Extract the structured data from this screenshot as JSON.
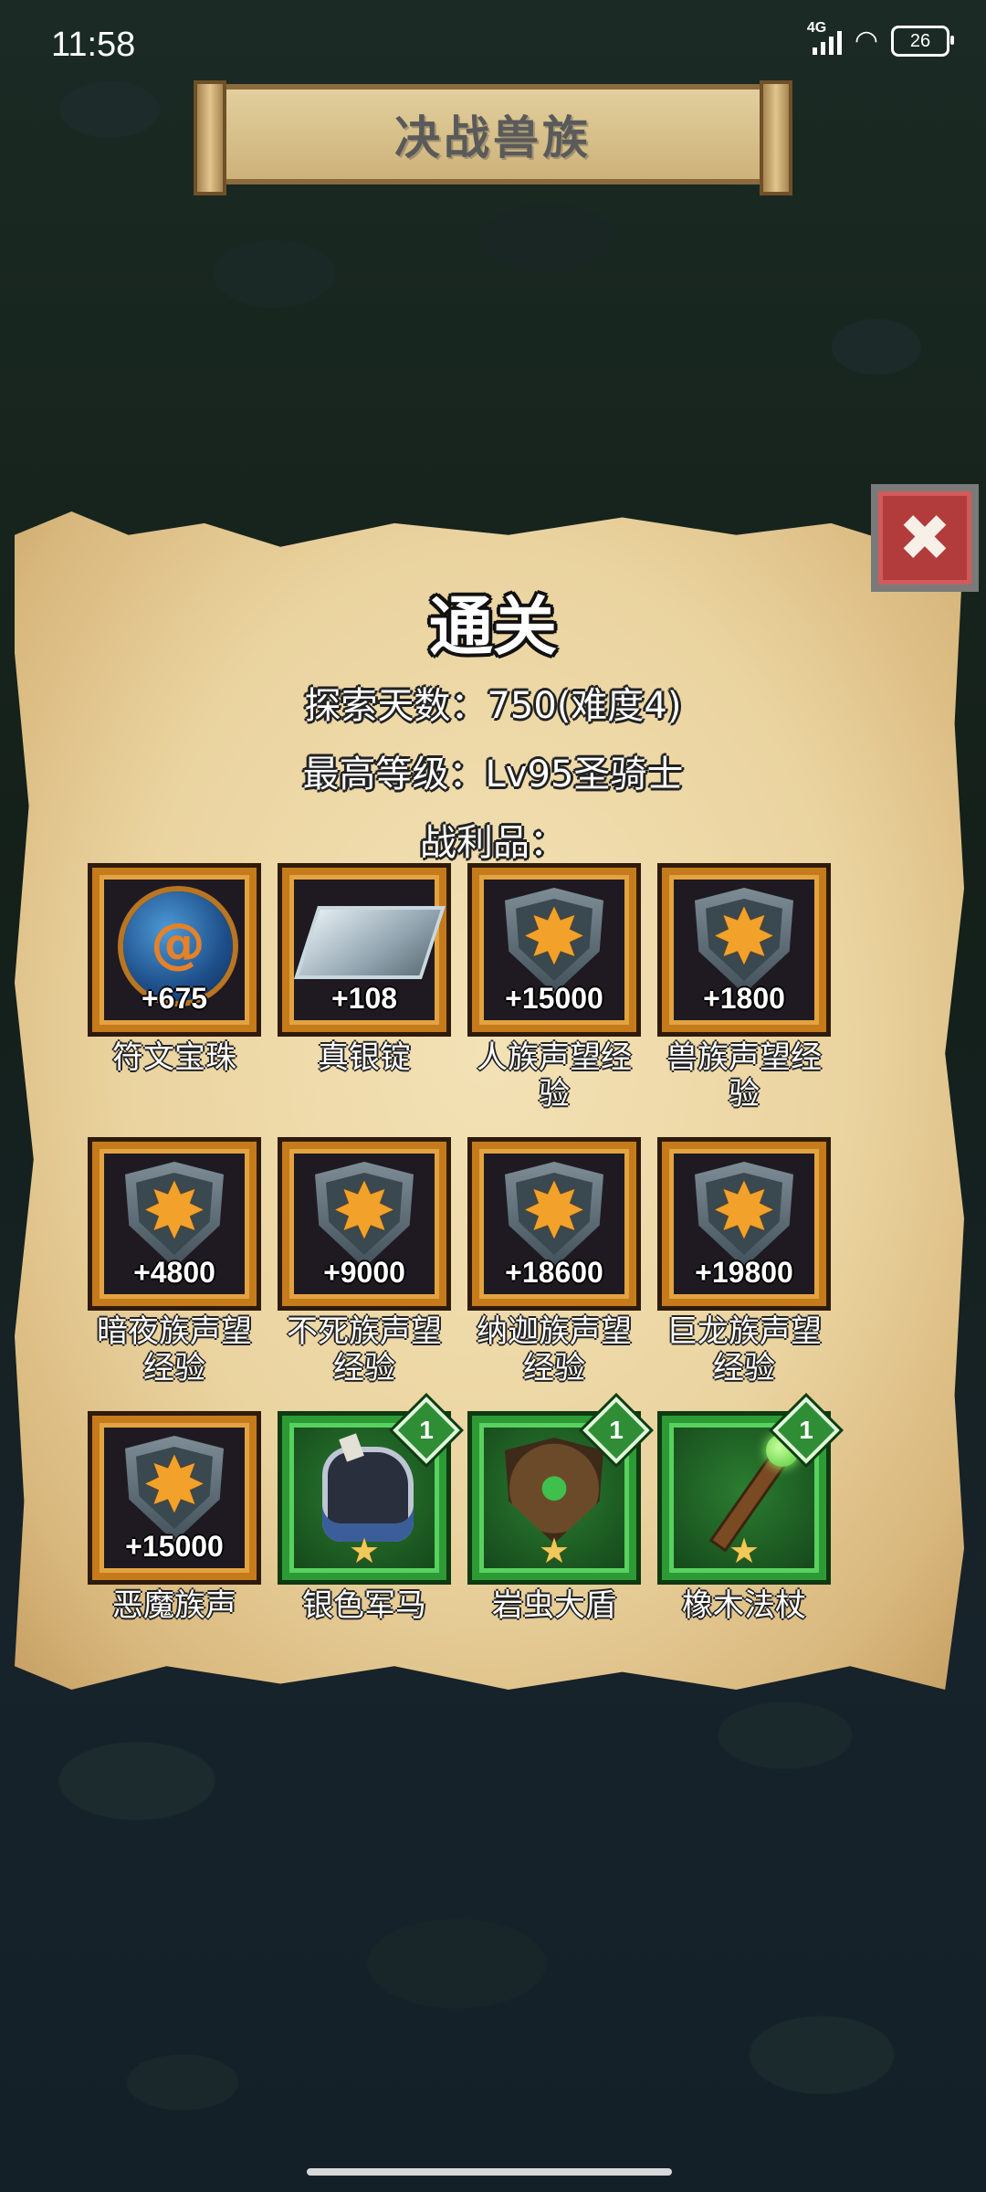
{
  "status_bar": {
    "time": "11:58",
    "network": "4G",
    "battery": "26"
  },
  "header": {
    "title": "决战兽族"
  },
  "result": {
    "heading": "通关",
    "days_line": "探索天数：750(难度4)",
    "level_line": "最高等级：Lv95圣骑士",
    "loot_label": "战利品："
  },
  "rewards": [
    {
      "name": "符文宝珠",
      "amount": "+675",
      "icon": "orb-icon"
    },
    {
      "name": "真银锭",
      "amount": "+108",
      "icon": "ingot-icon"
    },
    {
      "name": "人族声望经验",
      "amount": "+15000",
      "icon": "shield-star-icon"
    },
    {
      "name": "兽族声望经验",
      "amount": "+1800",
      "icon": "shield-star-icon"
    },
    {
      "name": "暗夜族声望经验",
      "amount": "+4800",
      "icon": "shield-star-icon"
    },
    {
      "name": "不死族声望经验",
      "amount": "+9000",
      "icon": "shield-star-icon"
    },
    {
      "name": "纳迦族声望经验",
      "amount": "+18600",
      "icon": "shield-star-icon"
    },
    {
      "name": "巨龙族声望经验",
      "amount": "+19800",
      "icon": "shield-star-icon"
    },
    {
      "name": "恶魔族声",
      "amount": "+15000",
      "icon": "shield-star-icon"
    },
    {
      "name": "银色军马",
      "level": "1",
      "icon": "horse-icon"
    },
    {
      "name": "岩虫大盾",
      "level": "1",
      "icon": "rock-shield-icon"
    },
    {
      "name": "橡木法杖",
      "level": "1",
      "icon": "staff-icon"
    }
  ],
  "colors": {
    "parchment": "#ead39f",
    "orange_frame": "#c57b1b",
    "green_frame": "#2d9a35",
    "close_button": "#b23b3b"
  },
  "icons": {
    "close": "close-icon",
    "star": "star-icon"
  }
}
